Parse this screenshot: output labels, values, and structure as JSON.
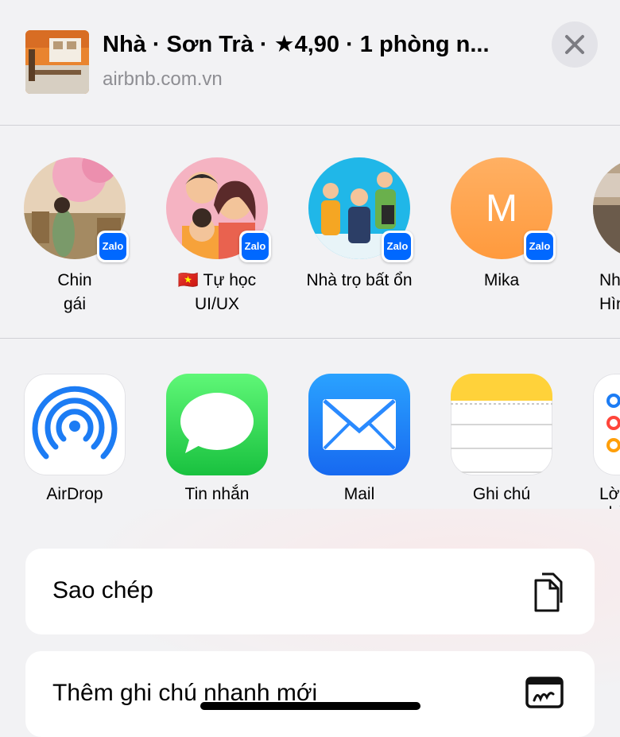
{
  "header": {
    "title": "Nhà · Sơn Trà · ★4,90 · 1 phòng n...",
    "subtitle": "airbnb.com.vn",
    "close_icon": "close-icon"
  },
  "contacts": [
    {
      "name": "Chin\ngái",
      "badge": "Zalo"
    },
    {
      "name": "🇻🇳 Tự học\nUI/UX",
      "badge": "Zalo"
    },
    {
      "name": "Nhà trọ bất ổn",
      "badge": "Zalo"
    },
    {
      "name": "Mika",
      "initial": "M",
      "badge": "Zalo"
    },
    {
      "name": "Nh\nHình"
    }
  ],
  "apps": [
    {
      "label": "AirDrop",
      "icon": "airdrop-icon"
    },
    {
      "label": "Tin nhắn",
      "icon": "messages-icon"
    },
    {
      "label": "Mail",
      "icon": "mail-icon"
    },
    {
      "label": "Ghi chú",
      "icon": "notes-icon"
    },
    {
      "label": "Lời nhắc",
      "icon": "reminders-icon"
    }
  ],
  "actions": [
    {
      "label": "Sao chép",
      "icon": "copy-icon"
    },
    {
      "label": "Thêm ghi chú nhanh mới",
      "icon": "quick-note-icon"
    }
  ],
  "colors": {
    "background": "#f2f2f4",
    "zalo": "#0068ff",
    "messages_green": "#30d158",
    "mail_blue": "#1e8cff",
    "notes_yellow": "#ffd60a",
    "mika_orange": "#ff9f43"
  }
}
